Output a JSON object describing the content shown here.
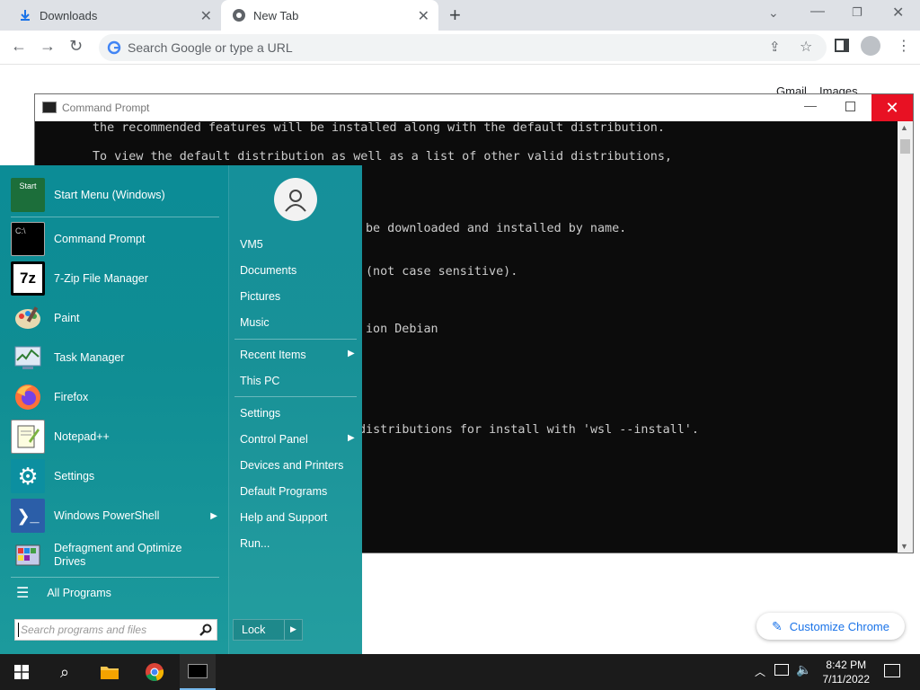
{
  "browser": {
    "tabs": [
      {
        "label": "Downloads"
      },
      {
        "label": "New Tab"
      }
    ],
    "omnibox_placeholder": "Search Google or type a URL",
    "ntp_links": {
      "gmail": "Gmail",
      "images": "Images"
    },
    "customize_label": "Customize Chrome"
  },
  "cmd": {
    "title": "Command Prompt",
    "lines": [
      "the recommended features will be installed along with the default distribution.",
      "To view the default distribution as well as a list of other valid distributions,",
      "be downloaded and installed by name.",
      "(not case sensitive).",
      "ion Debian",
      "distributions for install with 'wsl --install'."
    ]
  },
  "start_menu": {
    "apps": [
      {
        "label": "Start Menu (Windows)",
        "icon": "start-menu-icon"
      },
      {
        "label": "Command Prompt",
        "icon": "cmd-icon"
      },
      {
        "label": "7-Zip File Manager",
        "icon": "7zip-icon"
      },
      {
        "label": "Paint",
        "icon": "paint-icon"
      },
      {
        "label": "Task Manager",
        "icon": "task-manager-icon"
      },
      {
        "label": "Firefox",
        "icon": "firefox-icon"
      },
      {
        "label": "Notepad++",
        "icon": "notepadpp-icon"
      },
      {
        "label": "Settings",
        "icon": "gear-icon"
      },
      {
        "label": "Windows PowerShell",
        "icon": "powershell-icon"
      },
      {
        "label": "Defragment and Optimize Drives",
        "icon": "defrag-icon"
      }
    ],
    "start_icon_text": "Start",
    "cmd_icon_text": "C:\\",
    "zip_icon_text": "7z",
    "all_programs": "All Programs",
    "search_placeholder": "Search programs and files",
    "right_items": [
      {
        "label": "VM5"
      },
      {
        "label": "Documents"
      },
      {
        "label": "Pictures"
      },
      {
        "label": "Music"
      },
      {
        "label": "Recent Items"
      },
      {
        "label": "This PC"
      },
      {
        "label": "Settings"
      },
      {
        "label": "Control Panel"
      },
      {
        "label": "Devices and Printers"
      },
      {
        "label": "Default Programs"
      },
      {
        "label": "Help and Support"
      },
      {
        "label": "Run..."
      }
    ],
    "lock_label": "Lock"
  },
  "taskbar": {
    "time": "8:42 PM",
    "date": "7/11/2022"
  },
  "colors": {
    "start_teal": "#0c8c96",
    "close_red": "#e81123",
    "chrome_blue": "#1a73e8"
  }
}
